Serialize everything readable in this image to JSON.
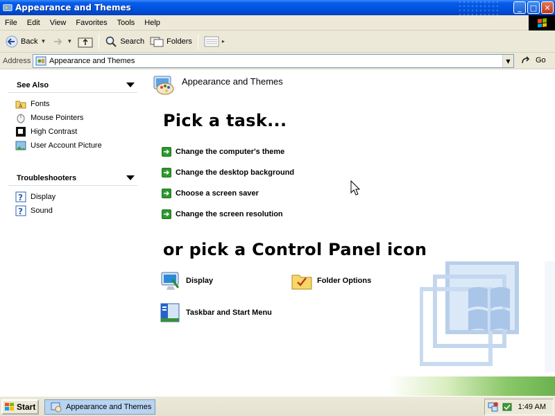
{
  "window": {
    "title": "Appearance and Themes",
    "buttons": {
      "minimize": "_",
      "maximize": "□",
      "close": "✕"
    }
  },
  "menu": [
    "File",
    "Edit",
    "View",
    "Favorites",
    "Tools",
    "Help"
  ],
  "toolbar": {
    "back": "Back",
    "search": "Search",
    "folders": "Folders"
  },
  "address": {
    "label": "Address",
    "value": "Appearance and Themes",
    "go": "Go"
  },
  "sidebar": {
    "see_also": {
      "title": "See Also",
      "items": [
        {
          "label": "Fonts",
          "icon": "folder-icon"
        },
        {
          "label": "Mouse Pointers",
          "icon": "mouse-icon"
        },
        {
          "label": "High Contrast",
          "icon": "contrast-icon"
        },
        {
          "label": "User Account Picture",
          "icon": "picture-icon"
        }
      ]
    },
    "troubleshooters": {
      "title": "Troubleshooters",
      "items": [
        {
          "label": "Display",
          "icon": "help-icon"
        },
        {
          "label": "Sound",
          "icon": "help-icon"
        }
      ]
    }
  },
  "main": {
    "category_title": "Appearance and Themes",
    "pick_task_heading": "Pick a task...",
    "tasks": [
      "Change the computer's theme",
      "Change the desktop background",
      "Choose a screen saver",
      "Change the screen resolution"
    ],
    "pick_icon_heading": "or pick a Control Panel icon",
    "icons": [
      {
        "label": "Display",
        "icon": "display-icon"
      },
      {
        "label": "Folder Options",
        "icon": "folder-options-icon"
      },
      {
        "label": "Taskbar and Start Menu",
        "icon": "taskbar-icon"
      }
    ]
  },
  "taskbar": {
    "start": "Start",
    "active_window": "Appearance and Themes",
    "clock": "1:49 AM"
  },
  "colors": {
    "title_blue": "#0054e3",
    "chrome": "#ece9d8",
    "task_green": "#2c9a2c"
  }
}
